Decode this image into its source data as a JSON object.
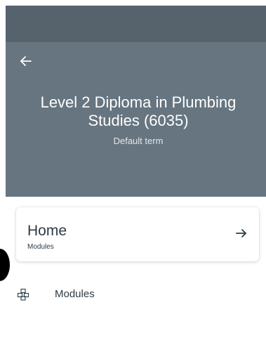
{
  "header": {
    "back_icon": "arrow-left-icon",
    "course_title": "Level 2 Diploma in Plumbing Studies (6035)",
    "term": "Default term"
  },
  "home_card": {
    "title": "Home",
    "subtitle": "Modules",
    "arrow_icon": "arrow-right-icon"
  },
  "nav": {
    "items": [
      {
        "icon": "modules-icon",
        "label": "Modules"
      }
    ]
  },
  "colors": {
    "status_bar": "#56626c",
    "hero_background": "#667580",
    "text_primary": "#2d3b45",
    "card_background": "#ffffff"
  }
}
